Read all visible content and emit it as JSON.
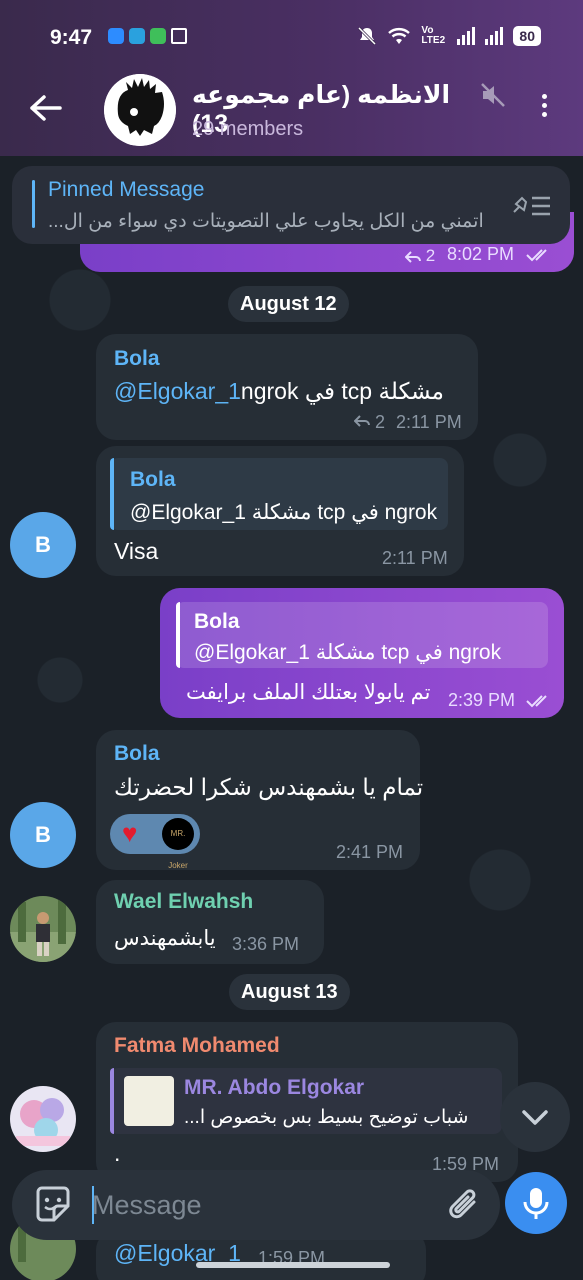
{
  "status_bar": {
    "time": "9:47",
    "network": "Vo LTE2",
    "battery": "80"
  },
  "header": {
    "title": "الانظمه (عام مجموعه 13)",
    "members": "29 members"
  },
  "pinned": {
    "title": "Pinned Message",
    "text": "اتمني من الكل يجاوب علي التصويتات دي سواء من ال..."
  },
  "top_message": {
    "reply_count": "2",
    "time": "8:02 PM"
  },
  "dates": {
    "aug12": "August 12",
    "aug13": "August 13"
  },
  "messages": [
    {
      "sender": "Bola",
      "mention": "@Elgokar_1",
      "text": " مشكلة tcp في ngrok",
      "reply_count": "2",
      "time": "2:11 PM"
    },
    {
      "quote_sender": "Bola",
      "quote_text": "@Elgokar_1 مشكلة tcp في ngrok",
      "text": "Visa",
      "time": "2:11 PM",
      "avatar": "B"
    },
    {
      "quote_sender": "Bola",
      "quote_text": "@Elgokar_1 مشكلة tcp في ngrok",
      "text": "تم يابولا بعتلك الملف برايفت",
      "time": "2:39 PM"
    },
    {
      "sender": "Bola",
      "text": "تمام يا بشمهندس شكرا لحضرتك",
      "time": "2:41 PM",
      "avatar": "B",
      "reaction_badge": "MR. Joker"
    },
    {
      "sender": "Wael Elwahsh",
      "text": "يابشمهندس",
      "time": "3:36 PM"
    },
    {
      "sender": "Fatma Mohamed",
      "quote_sender": "MR. Abdo Elgokar",
      "quote_text": "شباب توضيح بسيط بس بخصوص ا...",
      "text": ".",
      "time": "1:59 PM"
    }
  ],
  "partial_bottom": {
    "mention": "@Elgokar_1",
    "time": "1:59 PM"
  },
  "composer": {
    "placeholder": "Message"
  },
  "colors": {
    "accent": "#5eb5f7",
    "outgoing": "#8a46cc",
    "header": "#4a2f63",
    "wael": "#6fd0b0",
    "fatma": "#f08a6f"
  }
}
